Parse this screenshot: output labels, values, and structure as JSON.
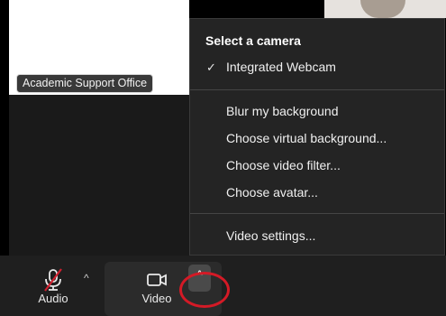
{
  "participant": {
    "name": "Academic Support Office"
  },
  "camera_menu": {
    "section_title": "Select a camera",
    "selected_camera": "Integrated Webcam",
    "items": [
      "Blur my background",
      "Choose virtual background...",
      "Choose video filter...",
      "Choose avatar...",
      "Video settings..."
    ]
  },
  "toolbar": {
    "audio_label": "Audio",
    "video_label": "Video",
    "caret_glyph": "^"
  },
  "colors": {
    "menu_bg": "#242424",
    "highlight_ring": "#d41a26",
    "muted_slash": "#d0202f"
  }
}
